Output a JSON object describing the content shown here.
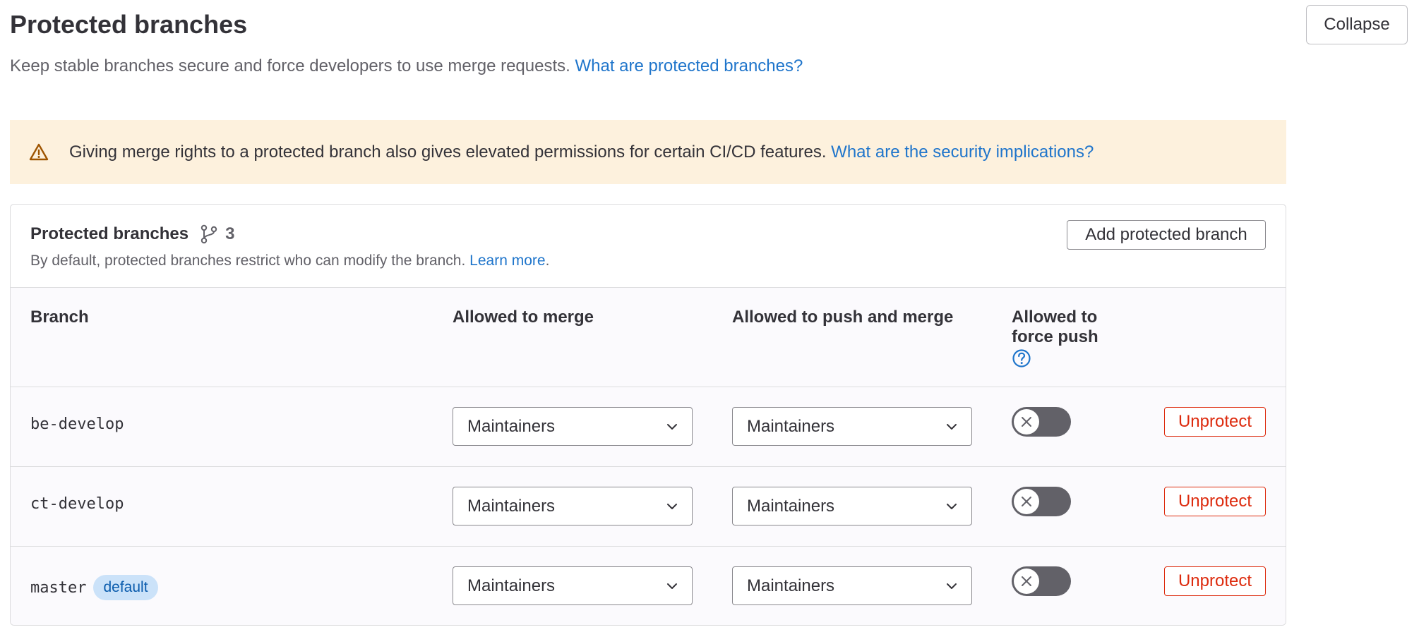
{
  "header": {
    "title": "Protected branches",
    "description": "Keep stable branches secure and force developers to use merge requests.",
    "help_link": "What are protected branches?",
    "collapse_label": "Collapse"
  },
  "alert": {
    "icon": "warning-icon",
    "text": "Giving merge rights to a protected branch also gives elevated permissions for certain CI/CD features.",
    "link": "What are the security implications?"
  },
  "card": {
    "title": "Protected branches",
    "count_icon": "branch-icon",
    "count": "3",
    "subtitle": "By default, protected branches restrict who can modify the branch.",
    "learn_more": "Learn more",
    "learn_more_suffix": ".",
    "add_button": "Add protected branch"
  },
  "table": {
    "columns": {
      "branch": "Branch",
      "merge": "Allowed to merge",
      "push": "Allowed to push and merge",
      "force_line1": "Allowed to",
      "force_line2": "force push",
      "help_icon": "question-circle-icon"
    },
    "rows": [
      {
        "branch": "be-develop",
        "badge": "",
        "merge": "Maintainers",
        "push": "Maintainers",
        "force_push": false,
        "action": "Unprotect"
      },
      {
        "branch": "ct-develop",
        "badge": "",
        "merge": "Maintainers",
        "push": "Maintainers",
        "force_push": false,
        "action": "Unprotect"
      },
      {
        "branch": "master",
        "badge": "default",
        "merge": "Maintainers",
        "push": "Maintainers",
        "force_push": false,
        "action": "Unprotect"
      }
    ]
  },
  "colors": {
    "link": "#1f75cb",
    "alert_bg": "#fdf1dd",
    "danger": "#dd2b0e",
    "toggle_off": "#626168",
    "badge_bg": "#cbe2f9"
  }
}
